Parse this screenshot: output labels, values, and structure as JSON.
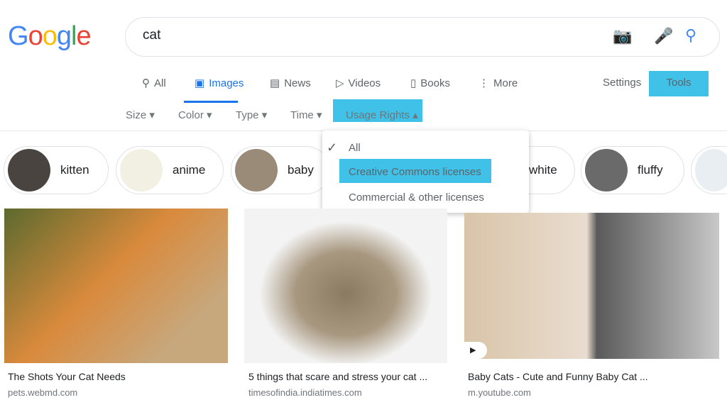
{
  "logo": "Google",
  "search": {
    "query": "cat"
  },
  "tabs": [
    {
      "label": "All",
      "icon": "search-icon"
    },
    {
      "label": "Images",
      "icon": "image-icon",
      "active": true
    },
    {
      "label": "News",
      "icon": "news-icon"
    },
    {
      "label": "Videos",
      "icon": "play-icon"
    },
    {
      "label": "Books",
      "icon": "book-icon"
    },
    {
      "label": "More",
      "icon": "more-vert-icon"
    }
  ],
  "settings": "Settings",
  "tools": "Tools",
  "filters": [
    "Size",
    "Color",
    "Type",
    "Time",
    "Usage Rights"
  ],
  "usage_menu": {
    "options": [
      "All",
      "Creative Commons licenses",
      "Commercial & other licenses"
    ],
    "selected": "All"
  },
  "chips": [
    "kitten",
    "anime",
    "baby",
    "white",
    "fluffy"
  ],
  "results": [
    {
      "title": "The Shots Your Cat Needs",
      "source": "pets.webmd.com"
    },
    {
      "title": "5 things that scare and stress your cat ...",
      "source": "timesofindia.indiatimes.com"
    },
    {
      "title": "Baby Cats - Cute and Funny Baby Cat ...",
      "source": "m.youtube.com"
    }
  ],
  "colors": {
    "accent": "#1a73e8",
    "highlight": "#3fc1e8"
  }
}
